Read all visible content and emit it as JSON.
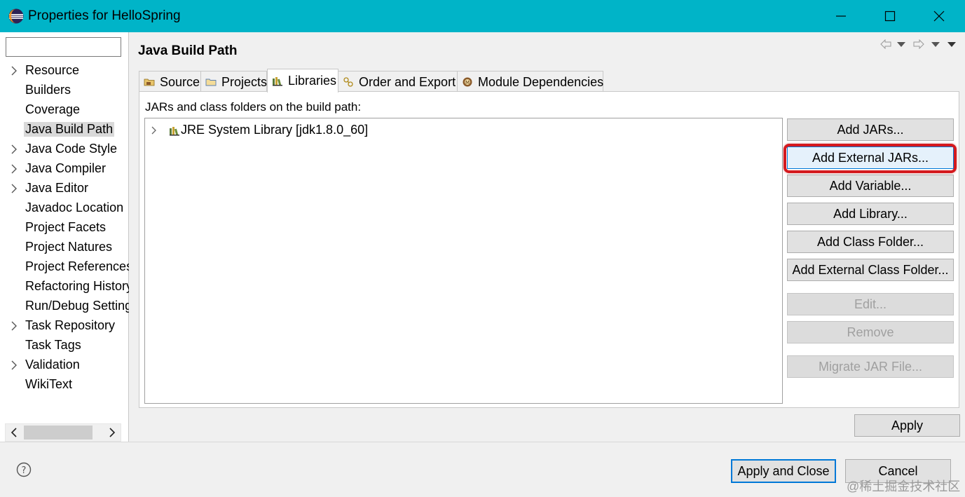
{
  "window": {
    "title": "Properties for HelloSpring",
    "app_icon": "eclipse-icon",
    "controls": [
      "minimize-icon",
      "maximize-icon",
      "close-icon"
    ]
  },
  "sidebar": {
    "filter_value": "",
    "items": [
      {
        "label": "Resource",
        "expandable": true
      },
      {
        "label": "Builders",
        "expandable": false
      },
      {
        "label": "Coverage",
        "expandable": false
      },
      {
        "label": "Java Build Path",
        "expandable": false,
        "selected": true
      },
      {
        "label": "Java Code Style",
        "expandable": true
      },
      {
        "label": "Java Compiler",
        "expandable": true
      },
      {
        "label": "Java Editor",
        "expandable": true
      },
      {
        "label": "Javadoc Location",
        "expandable": false
      },
      {
        "label": "Project Facets",
        "expandable": false
      },
      {
        "label": "Project Natures",
        "expandable": false
      },
      {
        "label": "Project References",
        "expandable": false
      },
      {
        "label": "Refactoring History",
        "expandable": false
      },
      {
        "label": "Run/Debug Settings",
        "expandable": false
      },
      {
        "label": "Task Repository",
        "expandable": true
      },
      {
        "label": "Task Tags",
        "expandable": false
      },
      {
        "label": "Validation",
        "expandable": true
      },
      {
        "label": "WikiText",
        "expandable": false
      }
    ]
  },
  "page": {
    "title": "Java Build Path",
    "tabs": [
      {
        "label": "Source",
        "icon": "source-folder-icon"
      },
      {
        "label": "Projects",
        "icon": "projects-folder-icon"
      },
      {
        "label": "Libraries",
        "icon": "library-icon",
        "active": true
      },
      {
        "label": "Order and Export",
        "icon": "order-export-icon"
      },
      {
        "label": "Module Dependencies",
        "icon": "module-icon"
      }
    ],
    "caption": "JARs and class folders on the build path:",
    "libraries": [
      {
        "label": "JRE System Library [jdk1.8.0_60]",
        "icon": "library-icon"
      }
    ],
    "buttons": {
      "add_jars": "Add JARs...",
      "add_external_jars": "Add External JARs...",
      "add_variable": "Add Variable...",
      "add_library": "Add Library...",
      "add_class_folder": "Add Class Folder...",
      "add_external_class_folder": "Add External Class Folder...",
      "edit": "Edit...",
      "remove": "Remove",
      "migrate_jar": "Migrate JAR File..."
    },
    "apply": "Apply"
  },
  "footer": {
    "apply_and_close": "Apply and Close",
    "cancel": "Cancel",
    "watermark": "@稀土掘金技术社区"
  },
  "colors": {
    "titlebar": "#00b4c8",
    "highlight": "#d4191e",
    "focus_blue": "#0078d7"
  }
}
